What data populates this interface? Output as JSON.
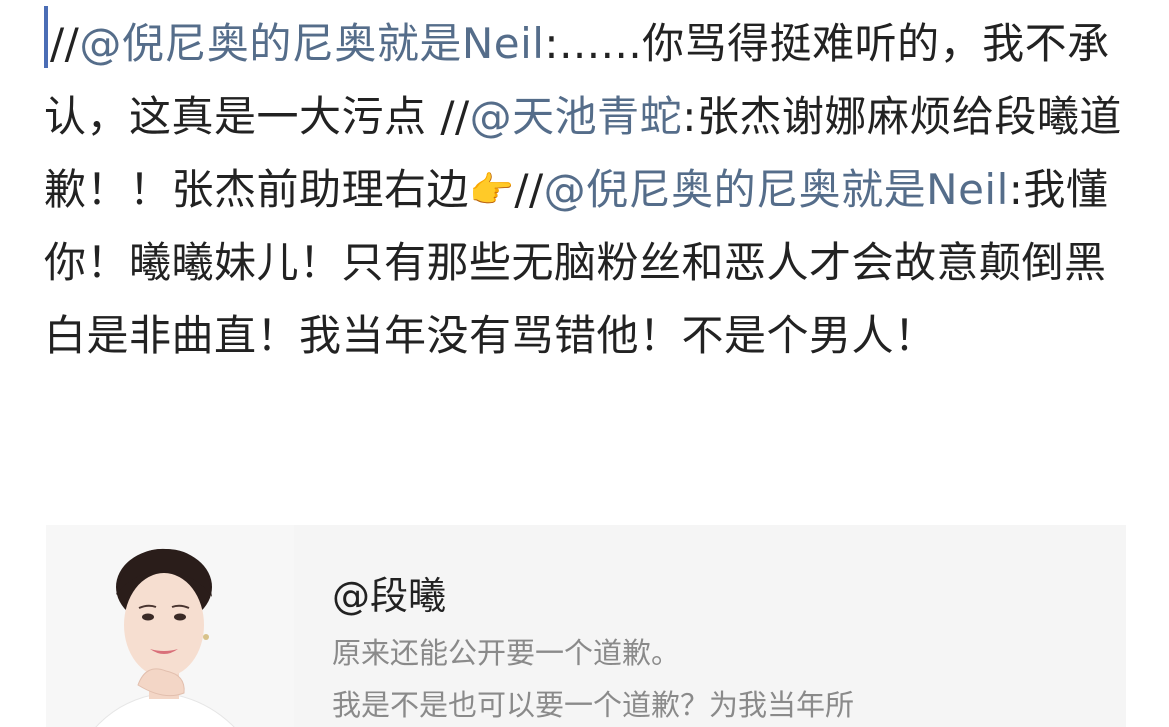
{
  "post": {
    "prefix_slashes_1": "//",
    "mention_1": "@倪尼奥的尼奥就是Neil",
    "text_1": ":......你骂得挺难听的，我不承认，这真是一大污点 ",
    "prefix_slashes_2": "//",
    "mention_2": "@天池青蛇",
    "text_2": ":张杰谢娜麻烦给段曦道歉！！张杰前助理右边",
    "emoji": "👉",
    "prefix_slashes_3": "//",
    "mention_3": "@倪尼奥的尼奥就是Neil",
    "text_3": ":我懂你！曦曦妹儿！只有那些无脑粉丝和恶人才会故意颠倒黑白是非曲直！我当年没有骂错他！不是个男人！"
  },
  "card": {
    "author": "@段曦",
    "line_1": "原来还能公开要一个道歉。",
    "line_2": "我是不是也可以要一个道歉？为我当年所"
  }
}
